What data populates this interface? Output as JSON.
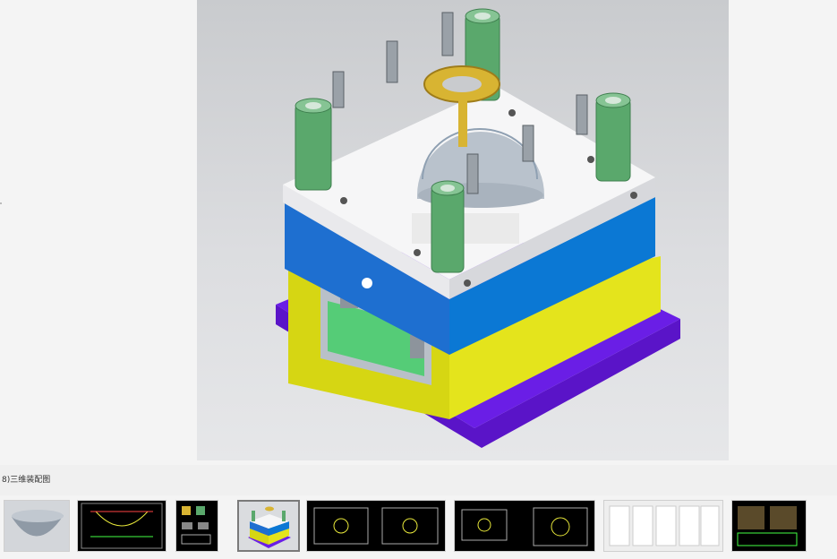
{
  "viewer": {
    "main_image_icon": "mold-assembly-3d-render",
    "caption": "8)三维装配图"
  },
  "thumbnails": [
    {
      "icon": "bowl-3d-render-thumbnail",
      "active": false
    },
    {
      "icon": "bowl-cad-drawing-thumbnail",
      "active": false
    },
    {
      "icon": "parts-sheet-thumbnail",
      "active": false
    },
    {
      "icon": "mold-assembly-thumbnail",
      "active": true
    },
    {
      "icon": "mold-plate-drawing-thumbnail",
      "active": false
    },
    {
      "icon": "mold-base-drawing-thumbnail",
      "active": false
    },
    {
      "icon": "document-pages-thumbnail",
      "active": false
    },
    {
      "icon": "assembly-drawing-thumbnail",
      "active": false
    }
  ]
}
